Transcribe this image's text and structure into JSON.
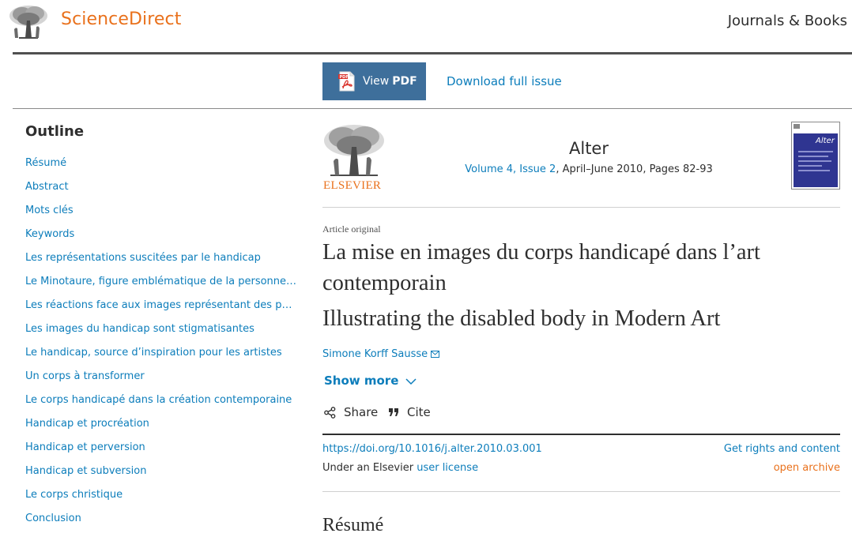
{
  "header": {
    "site_name": "ScienceDirect",
    "journals_books": "Journals & Books"
  },
  "toolbar": {
    "pdf_view": "View",
    "pdf_strong": "PDF",
    "download_issue": "Download full issue"
  },
  "outline": {
    "title": "Outline",
    "items": [
      "Résumé",
      "Abstract",
      "Mots clés",
      "Keywords",
      "Les représentations suscitées par le handicap",
      "Le Minotaure, figure emblématique de la personne handicapée",
      "Les réactions face aux images représentant des personnes handicapées",
      "Les images du handicap sont stigmatisantes",
      "Le handicap, source d’inspiration pour les artistes",
      "Un corps à transformer",
      "Le corps handicapé dans la création contemporaine",
      "Handicap et procréation",
      "Handicap et perversion",
      "Handicap et subversion",
      "Le corps christique",
      "Conclusion"
    ]
  },
  "journal": {
    "publisher": "ELSEVIER",
    "name": "Alter",
    "volume_issue": "Volume 4, Issue 2",
    "date_pages": ", April–June 2010, Pages 82-93",
    "cover_title": "Alter"
  },
  "article": {
    "type": "Article original",
    "title_fr": "La mise en images du corps handicapé dans l’art contemporain",
    "title_en": "Illustrating the disabled body in Modern Art",
    "author": "Simone Korff Sausse",
    "show_more": "Show more",
    "share": "Share",
    "cite": "Cite",
    "doi": "https://doi.org/10.1016/j.alter.2010.03.001",
    "license_prefix": "Under an Elsevier ",
    "license_link": "user license",
    "rights": "Get rights and content",
    "open_archive": "open archive",
    "section_heading": "Résumé"
  },
  "colors": {
    "brand_orange": "#e9711c",
    "link_blue": "#0c7dbb",
    "pdf_button": "#3e6f9b",
    "text": "#2e2e2e"
  }
}
